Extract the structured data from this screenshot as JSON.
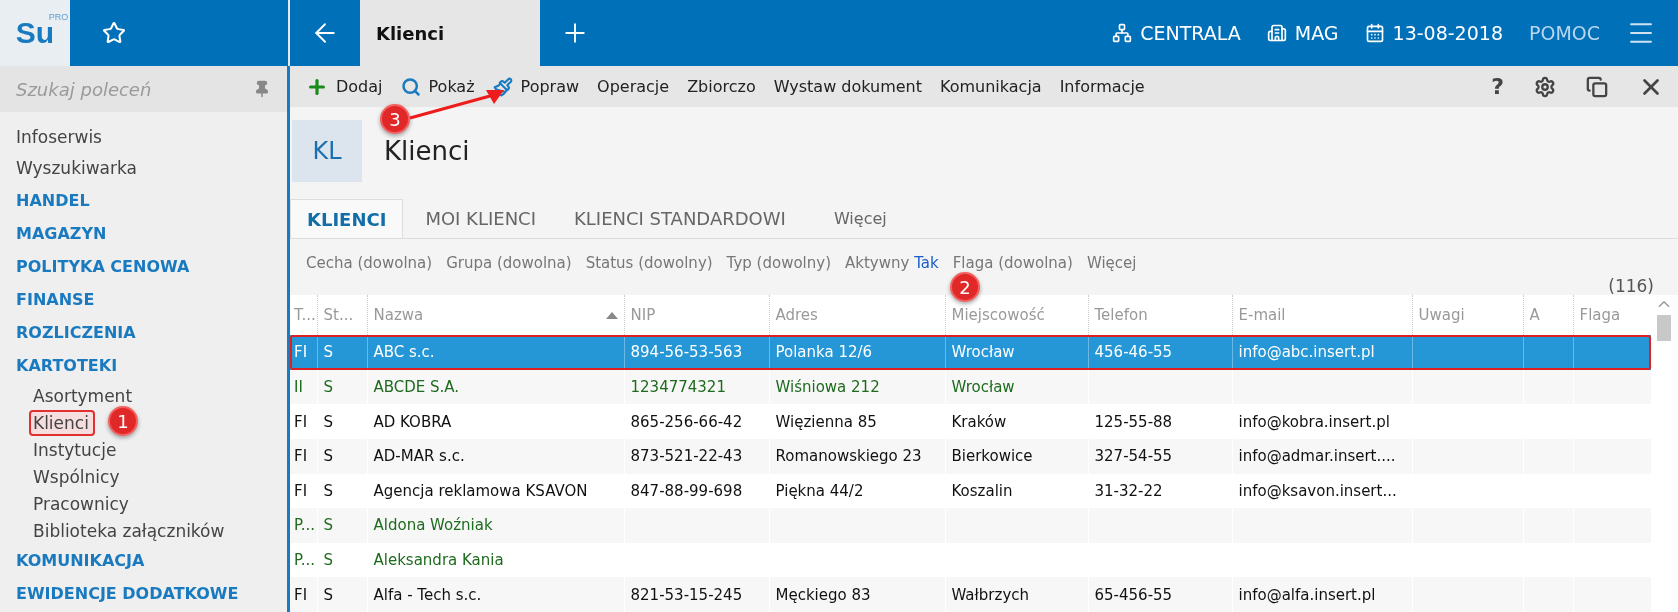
{
  "app": {
    "logo": "Su",
    "logo_badge": "PRO"
  },
  "top_bar": {
    "tab": {
      "label": "Klienci",
      "selected": true
    },
    "items": [
      {
        "kind": "branch",
        "label": "CENTRALA"
      },
      {
        "kind": "store",
        "label": "MAG"
      },
      {
        "kind": "date",
        "label": "13-08-2018"
      },
      {
        "kind": "help",
        "label": "POMOC"
      }
    ]
  },
  "sidebar": {
    "search": {
      "placeholder": "Szukaj poleceń"
    },
    "items": [
      {
        "kind": "link",
        "label": "Infoserwis"
      },
      {
        "kind": "link",
        "label": "Wyszukiwarka"
      },
      {
        "kind": "section",
        "label": "HANDEL"
      },
      {
        "kind": "section",
        "label": "MAGAZYN"
      },
      {
        "kind": "section",
        "label": "POLITYKA CENOWA"
      },
      {
        "kind": "section",
        "label": "FINANSE"
      },
      {
        "kind": "section",
        "label": "ROZLICZENIA"
      },
      {
        "kind": "section",
        "label": "KARTOTEKI",
        "children": [
          {
            "label": "Asortyment",
            "outlined": false
          },
          {
            "label": "Klienci",
            "outlined": true
          },
          {
            "label": "Instytucje",
            "outlined": false
          },
          {
            "label": "Wspólnicy",
            "outlined": false
          },
          {
            "label": "Pracownicy",
            "outlined": false
          },
          {
            "label": "Biblioteka załączników",
            "outlined": false
          }
        ]
      },
      {
        "kind": "section",
        "label": "KOMUNIKACJA"
      },
      {
        "kind": "section",
        "label": "EWIDENCJE DODATKOWE"
      }
    ]
  },
  "toolbar": {
    "actions": [
      {
        "kind": "add",
        "label": "Dodaj"
      },
      {
        "kind": "show",
        "label": "Pokaż"
      },
      {
        "kind": "edit",
        "label": "Popraw"
      },
      {
        "kind": "text",
        "label": "Operacje"
      },
      {
        "kind": "text",
        "label": "Zbiorczo"
      },
      {
        "kind": "text",
        "label": "Wystaw dokument"
      },
      {
        "kind": "text",
        "label": "Komunikacja"
      },
      {
        "kind": "text",
        "label": "Informacje"
      }
    ],
    "help": "?"
  },
  "header": {
    "code": "KL",
    "title": "Klienci"
  },
  "tabs": [
    {
      "label": "KLIENCI",
      "selected": true
    },
    {
      "label": "MOI KLIENCI",
      "selected": false
    },
    {
      "label": "KLIENCI STANDARDOWI",
      "selected": false
    },
    {
      "label": "Więcej",
      "selected": false
    }
  ],
  "filters": [
    {
      "label": "Cecha (dowolna)"
    },
    {
      "label": "Grupa (dowolna)"
    },
    {
      "label": "Status (dowolny)"
    },
    {
      "label": "Typ (dowolny)"
    },
    {
      "label": "Aktywny",
      "value": "Tak"
    },
    {
      "label": "Flaga (dowolna)"
    },
    {
      "label": "Więcej"
    }
  ],
  "count": "(116)",
  "table": {
    "columns": [
      {
        "label": "T..."
      },
      {
        "label": "St..."
      },
      {
        "label": "Nazwa",
        "sorted": true
      },
      {
        "label": "NIP"
      },
      {
        "label": "Adres"
      },
      {
        "label": "Miejscowość"
      },
      {
        "label": "Telefon"
      },
      {
        "label": "E-mail"
      },
      {
        "label": "Uwagi"
      },
      {
        "label": "A"
      },
      {
        "label": "Flaga"
      }
    ],
    "rows": [
      {
        "selected": true,
        "outlined": true,
        "kind": "regular",
        "cells": [
          "FI",
          "S",
          "ABC s.c.",
          "894-56-53-563",
          "Polanka  12/6",
          "Wrocław",
          "456-46-55",
          "info@abc.insert.pl",
          "",
          "",
          ""
        ]
      },
      {
        "selected": false,
        "outlined": false,
        "kind": "special",
        "cells": [
          "II",
          "S",
          "ABCDE S.A.",
          "1234774321",
          "Wiśniowa 212",
          "Wrocław",
          "",
          "",
          "",
          "",
          ""
        ]
      },
      {
        "selected": false,
        "outlined": false,
        "kind": "regular",
        "cells": [
          "FI",
          "S",
          "AD KOBRA",
          "865-256-66-42",
          "Więzienna  85",
          "Kraków",
          "125-55-88",
          "info@kobra.insert.pl",
          "",
          "",
          ""
        ]
      },
      {
        "selected": false,
        "outlined": false,
        "kind": "regular",
        "cells": [
          "FI",
          "S",
          "AD-MAR s.c.",
          "873-521-22-43",
          "Romanowskiego 23",
          "Bierkowice",
          "327-54-55",
          "info@admar.insert....",
          "",
          "",
          ""
        ]
      },
      {
        "selected": false,
        "outlined": false,
        "kind": "regular",
        "cells": [
          "FI",
          "S",
          "Agencja reklamowa KSAVON",
          "847-88-99-698",
          "Piękna  44/2",
          "Koszalin",
          "31-32-22",
          "info@ksavon.insert...",
          "",
          "",
          ""
        ]
      },
      {
        "selected": false,
        "outlined": false,
        "kind": "special",
        "cells": [
          "P...",
          "S",
          "Aldona Woźniak",
          "",
          "",
          "",
          "",
          "",
          "",
          "",
          ""
        ]
      },
      {
        "selected": false,
        "outlined": false,
        "kind": "special",
        "cells": [
          "P...",
          "S",
          "Aleksandra Kania",
          "",
          "",
          "",
          "",
          "",
          "",
          "",
          ""
        ]
      },
      {
        "selected": false,
        "outlined": false,
        "kind": "regular",
        "cells": [
          "FI",
          "S",
          "Alfa - Tech s.c.",
          "821-53-15-245",
          "Męckiego  83",
          "Wałbrzych",
          "65-456-55",
          "info@alfa.insert.pl",
          "",
          "",
          ""
        ]
      }
    ]
  },
  "annotations": [
    {
      "kind": "sidebar",
      "label": "1"
    },
    {
      "kind": "table",
      "label": "2"
    },
    {
      "kind": "toolbar",
      "label": "3"
    }
  ]
}
